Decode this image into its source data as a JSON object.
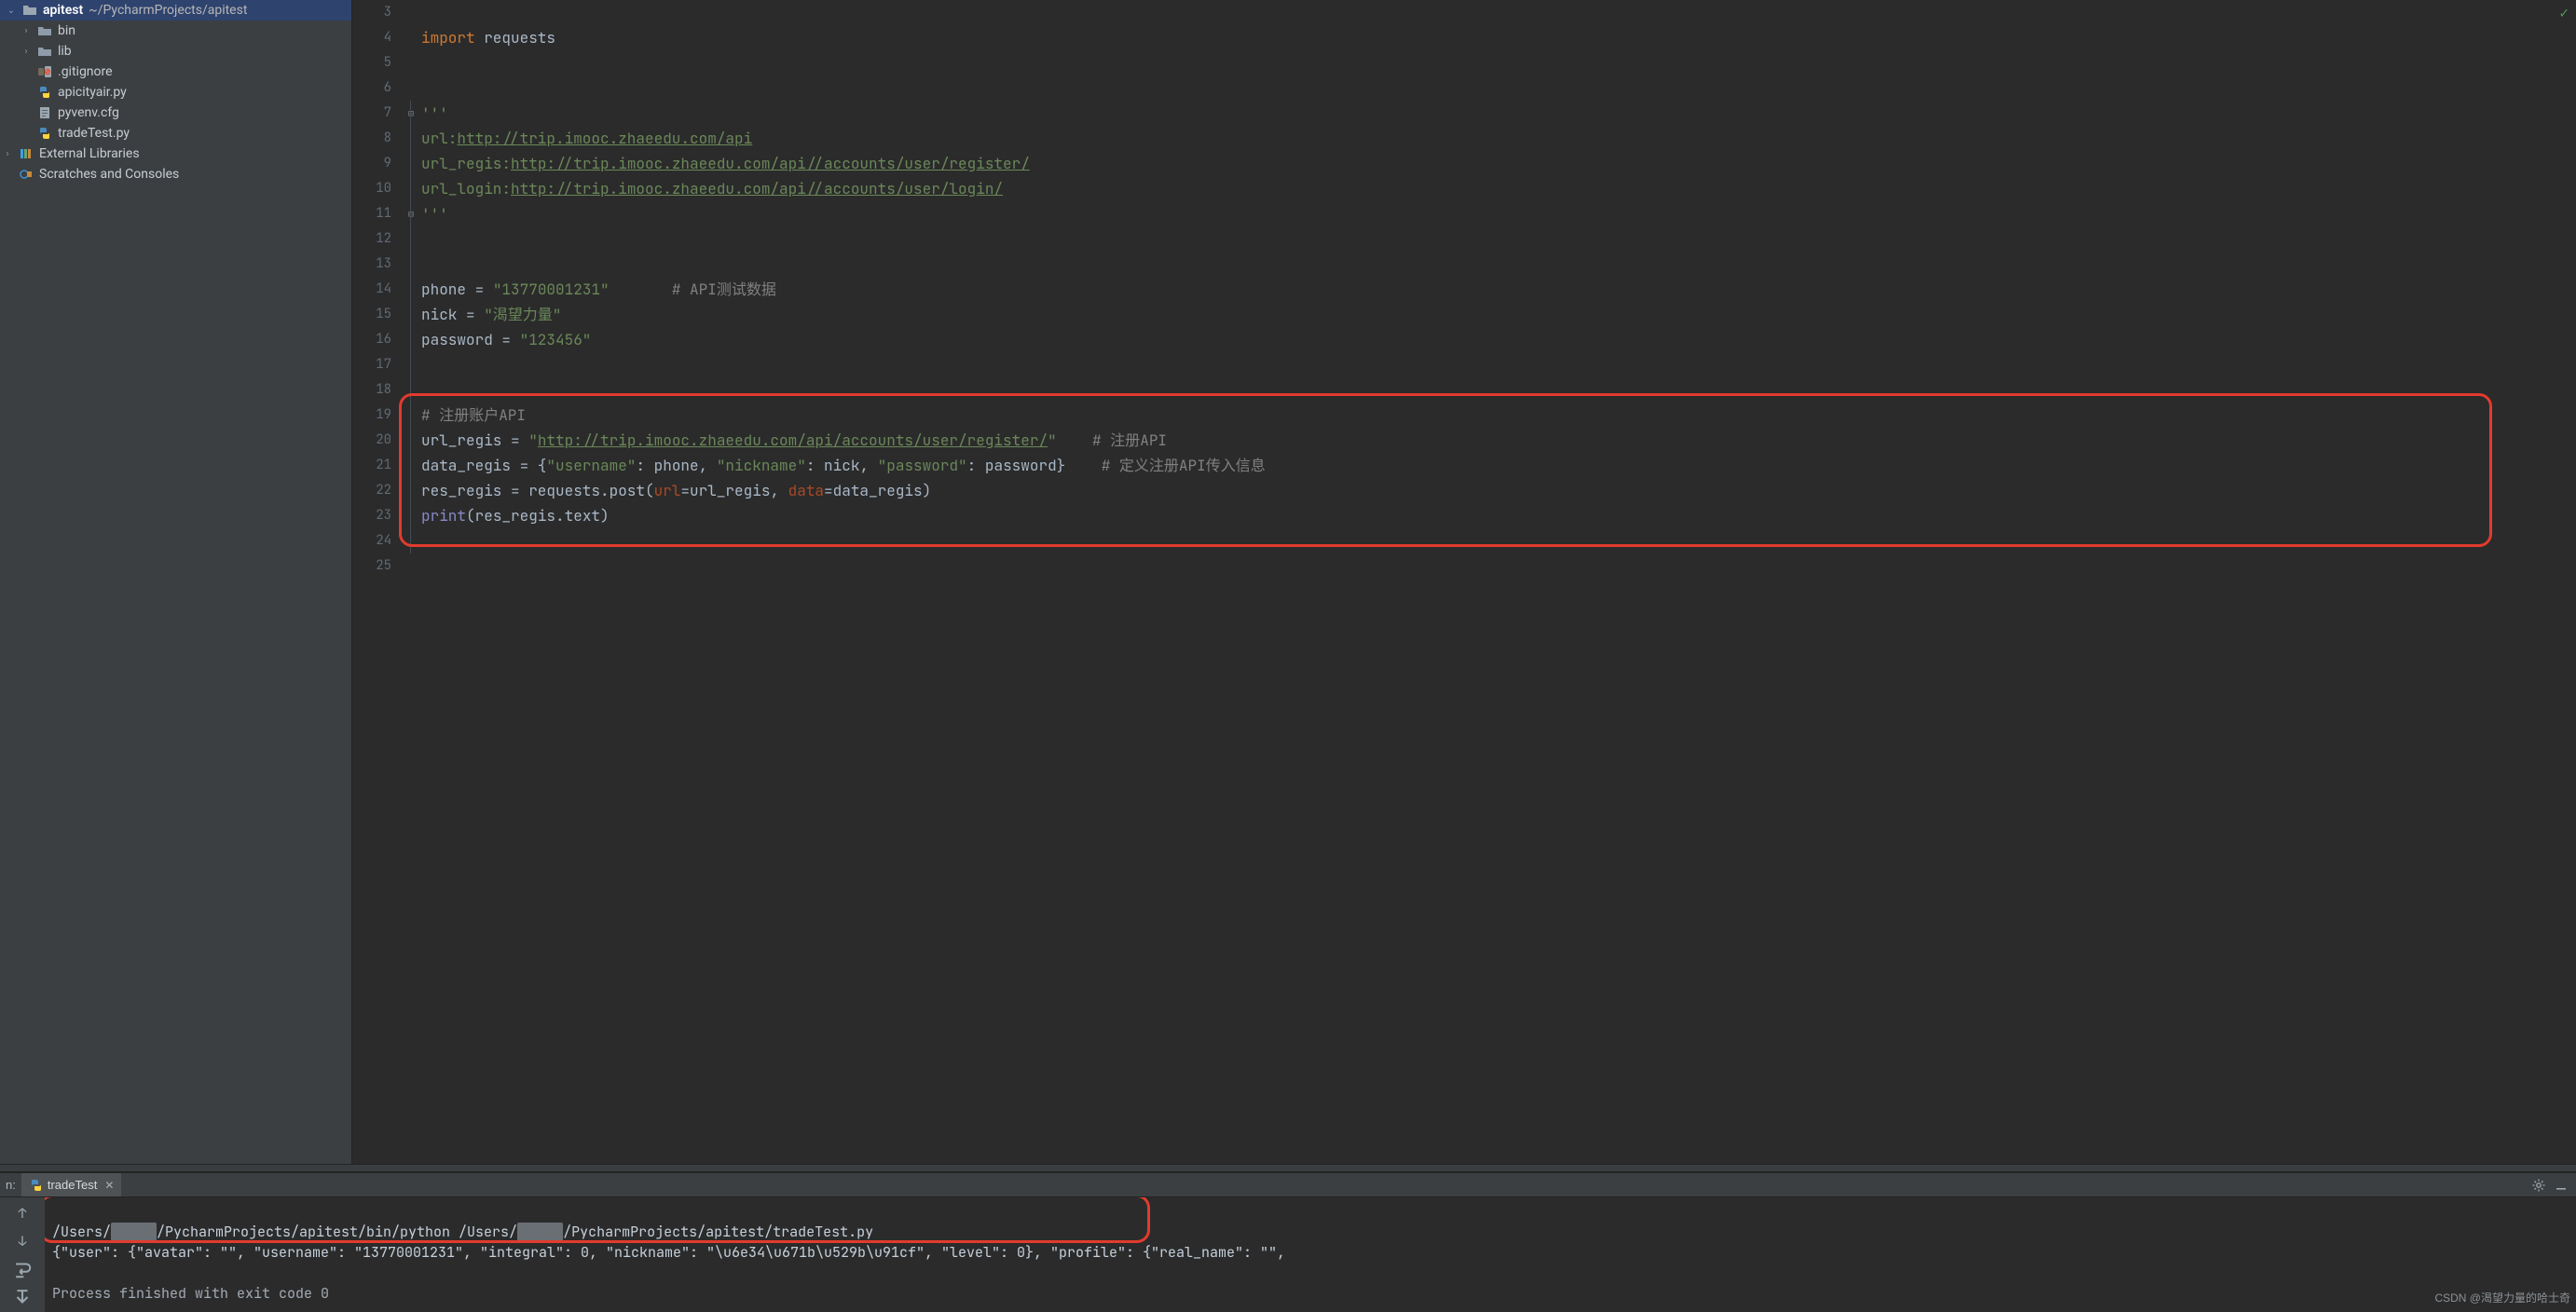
{
  "project": {
    "name": "apitest",
    "path": "~/PycharmProjects/apitest",
    "tree": [
      {
        "kind": "folder",
        "label": "bin",
        "depth": 1,
        "expandable": true
      },
      {
        "kind": "folder",
        "label": "lib",
        "depth": 1,
        "expandable": true
      },
      {
        "kind": "gitignore",
        "label": ".gitignore",
        "depth": 1
      },
      {
        "kind": "py",
        "label": "apicityair.py",
        "depth": 1
      },
      {
        "kind": "cfg",
        "label": "pyvenv.cfg",
        "depth": 1
      },
      {
        "kind": "py",
        "label": "tradeTest.py",
        "depth": 1
      }
    ],
    "external_libs_label": "External Libraries",
    "scratches_label": "Scratches and Consoles"
  },
  "editor": {
    "first_line_no": 3,
    "lines": [
      "",
      "<kw>import</kw> requests",
      "",
      "",
      "<str>'''</str>",
      "<str>url:</str><url>http://trip.imooc.zhaeedu.com/api</url>",
      "<str>url_regis:</str><url>http://trip.imooc.zhaeedu.com/api//accounts/user/register/</url>",
      "<str>url_login:</str><url>http://trip.imooc.zhaeedu.com/api//accounts/user/login/</url>",
      "<str>'''</str>",
      "",
      "",
      "phone = <str>\"13770001231\"</str>       <comm># API测试数据</comm>",
      "nick = <str>\"渴望力量\"</str>",
      "password = <str>\"123456\"</str>",
      "",
      "",
      "<comm># 注册账户API</comm>",
      "url_regis = <str>\"</str><url>http://trip.imooc.zhaeedu.com/api/accounts/user/register/</url><str>\"</str>    <comm># 注册API</comm>",
      "data_regis = {<str>\"username\"</str>: phone, <str>\"nickname\"</str>: nick, <str>\"password\"</str>: password}    <comm># 定义注册API传入信息</comm>",
      "res_regis = requests.post(<param>url</param>=url_regis, <param>data</param>=data_regis)",
      "<builtin>print</builtin>(res_regis.text)",
      "",
      ""
    ],
    "fold_markers": {
      "7": "⊟",
      "11": "⊟"
    }
  },
  "run": {
    "label_prefix": "n:",
    "tab_name": "tradeTest",
    "cmd_line_a": "/Users/",
    "cmd_line_b": "/PycharmProjects/apitest/bin/python /Users/",
    "cmd_line_c": "/PycharmProjects/apitest/tradeTest.py",
    "output_line": "{\"user\": {\"avatar\": \"\", \"username\": \"13770001231\", \"integral\": 0, \"nickname\": \"\\u6e34\\u671b\\u529b\\u91cf\", \"level\": 0}, \"profile\": {\"real_name\": \"\",",
    "exit_line": "Process finished with exit code 0"
  },
  "watermark": "CSDN @渴望力量的哈士奇",
  "colors": {
    "accent_red": "#e23b2e",
    "editor_bg": "#2b2b2b",
    "panel_bg": "#3c3f41",
    "selection_bg": "#2e436e"
  }
}
